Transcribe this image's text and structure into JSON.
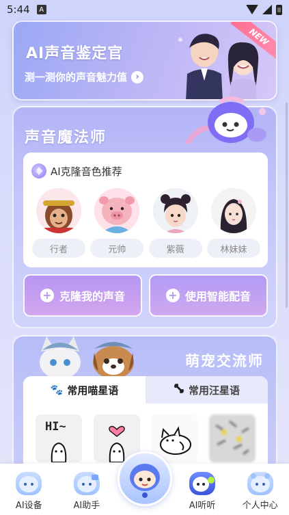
{
  "status_bar": {
    "time": "5:44",
    "notif": "A"
  },
  "banner": {
    "title": "AI声音鉴定官",
    "subtitle": "测一测你的声音魅力值",
    "badge": "NEW"
  },
  "magic": {
    "title": "声音魔法师",
    "recommend_title": "AI克隆音色推荐",
    "voices": [
      {
        "label": "行者"
      },
      {
        "label": "元帅"
      },
      {
        "label": "紫薇"
      },
      {
        "label": "林妹妹"
      }
    ],
    "clone_label": "克隆我的声音",
    "dub_label": "使用智能配音"
  },
  "pet": {
    "title": "萌宠交流师",
    "tab_cat": "常用喵星语",
    "tab_dog": "常用汪星语",
    "sticker_text": "HI~"
  },
  "nav": {
    "items": [
      {
        "label": "AI设备"
      },
      {
        "label": "AI助手"
      },
      {
        "label": "AI听听"
      },
      {
        "label": "个人中心"
      }
    ]
  }
}
